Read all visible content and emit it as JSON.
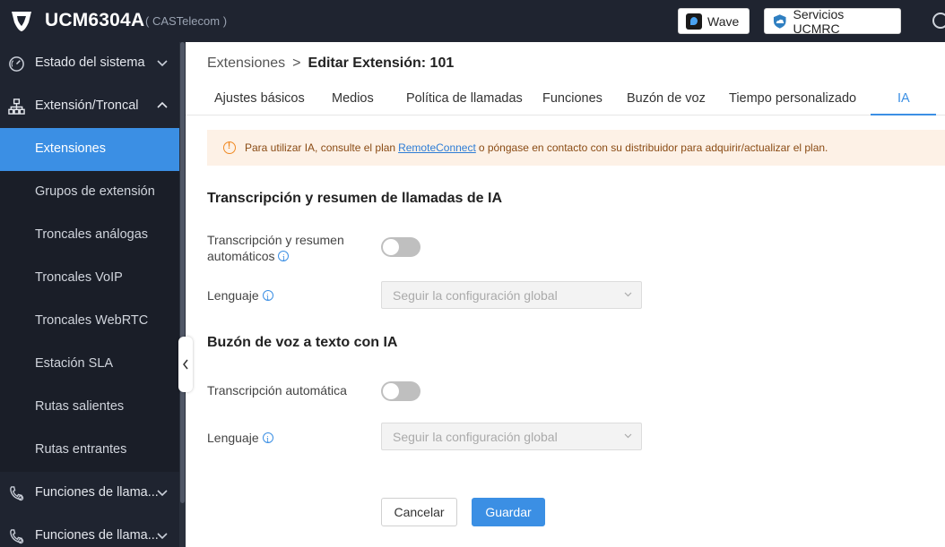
{
  "header": {
    "product": "UCM6304A",
    "company": "( CASTelecom )",
    "wave_label": "Wave",
    "ucm_services_label": "Servicios UCMRC"
  },
  "sidebar": {
    "groups": [
      {
        "label": "Estado del sistema",
        "icon": "gauge-icon",
        "expanded": false
      },
      {
        "label": "Extensión/Troncal",
        "icon": "org-chart-icon",
        "expanded": true
      },
      {
        "label": "Funciones de llama...",
        "icon": "phone-settings-icon",
        "expanded": false
      },
      {
        "label": "Funciones de llama...",
        "icon": "phone-settings-icon",
        "expanded": false
      }
    ],
    "items": [
      {
        "label": "Extensiones",
        "active": true
      },
      {
        "label": "Grupos de extensión"
      },
      {
        "label": "Troncales análogas"
      },
      {
        "label": "Troncales VoIP"
      },
      {
        "label": "Troncales WebRTC"
      },
      {
        "label": "Estación SLA"
      },
      {
        "label": "Rutas salientes"
      },
      {
        "label": "Rutas entrantes"
      }
    ]
  },
  "breadcrumb": {
    "parent": "Extensiones",
    "separator": ">",
    "current": "Editar Extensión: 101"
  },
  "tabs": [
    {
      "label": "Ajustes básicos"
    },
    {
      "label": "Medios"
    },
    {
      "label": "Política de llamadas"
    },
    {
      "label": "Funciones"
    },
    {
      "label": "Buzón de voz"
    },
    {
      "label": "Tiempo personalizado"
    },
    {
      "label": "IA",
      "active": true
    }
  ],
  "alert": {
    "text_before": "Para utilizar IA, consulte el plan",
    "link": "RemoteConnect",
    "text_after": "o póngase en contacto con su distribuidor para adquirir/actualizar el plan."
  },
  "sections": {
    "transcription": {
      "title": "Transcripción y resumen de llamadas de IA",
      "auto_label_line1": "Transcripción y resumen",
      "auto_label_line2": "automáticos",
      "auto_enabled": false,
      "language_label": "Lenguaje",
      "language_value": "Seguir la configuración global"
    },
    "voicemail": {
      "title": "Buzón de voz a texto con IA",
      "auto_label": "Transcripción automática",
      "auto_enabled": false,
      "language_label": "Lenguaje",
      "language_value": "Seguir la configuración global"
    }
  },
  "actions": {
    "cancel": "Cancelar",
    "save": "Guardar"
  },
  "colors": {
    "accent": "#3b8fe4",
    "sidebar_bg": "#1f2430",
    "alert_bg": "#fdf1e6",
    "warning": "#f08a24"
  }
}
